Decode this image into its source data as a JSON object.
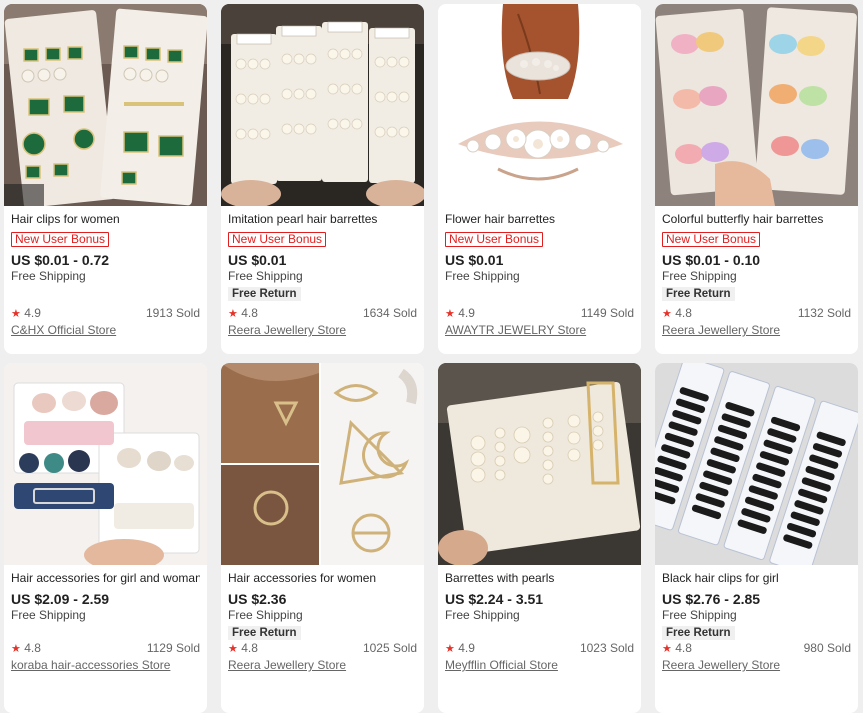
{
  "products": [
    {
      "title": "Hair clips for women",
      "bonus": "New User Bonus",
      "price": "US $0.01 - 0.72",
      "shipping": "Free Shipping",
      "free_return": "",
      "rating": "4.9",
      "sold": "1913 Sold",
      "store": "C&HX Official Store"
    },
    {
      "title": "Imitation pearl hair barrettes",
      "bonus": "New User Bonus",
      "price": "US $0.01",
      "shipping": "Free Shipping",
      "free_return": "Free Return",
      "rating": "4.8",
      "sold": "1634 Sold",
      "store": "Reera Jewellery Store"
    },
    {
      "title": "Flower hair barrettes",
      "bonus": "New User Bonus",
      "price": "US $0.01",
      "shipping": "Free Shipping",
      "free_return": "",
      "rating": "4.9",
      "sold": "1149 Sold",
      "store": "AWAYTR JEWELRY Store"
    },
    {
      "title": "Colorful butterfly hair barrettes",
      "bonus": "New User Bonus",
      "price": "US $0.01 - 0.10",
      "shipping": "Free Shipping",
      "free_return": "Free Return",
      "rating": "4.8",
      "sold": "1132 Sold",
      "store": "Reera Jewellery Store"
    },
    {
      "title": "Hair accessories for girl and woman",
      "bonus": "",
      "price": "US $2.09 - 2.59",
      "shipping": "Free Shipping",
      "free_return": "",
      "rating": "4.8",
      "sold": "1129 Sold",
      "store": "koraba hair-accessories Store"
    },
    {
      "title": "Hair accessories for women",
      "bonus": "",
      "price": "US $2.36",
      "shipping": "Free Shipping",
      "free_return": "Free Return",
      "rating": "4.8",
      "sold": "1025 Sold",
      "store": "Reera Jewellery Store"
    },
    {
      "title": "Barrettes with pearls",
      "bonus": "",
      "price": "US $2.24 - 3.51",
      "shipping": "Free Shipping",
      "free_return": "",
      "rating": "4.9",
      "sold": "1023 Sold",
      "store": "Meyfflin Official Store"
    },
    {
      "title": "Black hair clips for girl",
      "bonus": "",
      "price": "US $2.76 - 2.85",
      "shipping": "Free Shipping",
      "free_return": "Free Return",
      "rating": "4.8",
      "sold": "980 Sold",
      "store": "Reera Jewellery Store"
    }
  ],
  "star_icon": "★",
  "colors": {
    "bonus": "#e02020",
    "star": "#e5332a",
    "background": "#efefef"
  }
}
